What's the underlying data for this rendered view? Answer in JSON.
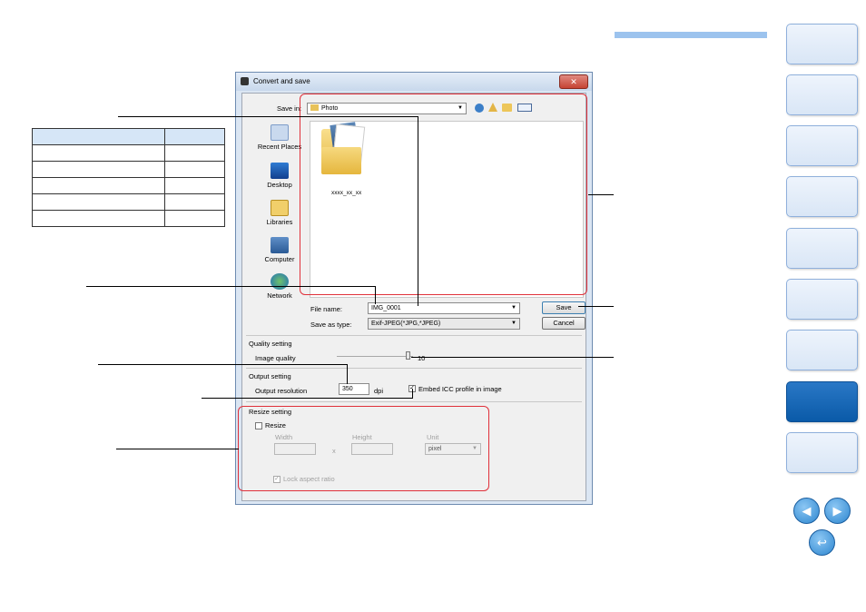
{
  "dialog": {
    "title": "Convert and save",
    "close_label": "✕",
    "save_in_label": "Save in:",
    "save_in_value": "Photo",
    "places": [
      "Recent Places",
      "Desktop",
      "Libraries",
      "Computer",
      "Network"
    ],
    "folder_name": "xxxx_xx_xx",
    "file_name_label": "File name:",
    "file_name_value": "IMG_0001",
    "save_type_label": "Save as type:",
    "save_type_value": "Exif-JPEG(*JPG,*JPEG)",
    "save_button": "Save",
    "cancel_button": "Cancel",
    "quality_section": "Quality setting",
    "image_quality_label": "Image quality",
    "image_quality_value": "10",
    "output_section": "Output setting",
    "output_resolution_label": "Output resolution",
    "output_resolution_value": "350",
    "dpi_label": "dpi",
    "embed_icc_label": "Embed ICC profile in image",
    "embed_icc_checked": true,
    "resize_section": "Resize setting",
    "resize_label": "Resize",
    "width_label": "Width",
    "height_label": "Height",
    "unit_label": "Unit",
    "times_label": "x",
    "unit_value": "pixel",
    "lock_aspect_label": "Lock aspect ratio"
  },
  "table": {
    "rows": 6,
    "cols": 2
  },
  "colors": {
    "accent_blue": "#0a5aa8",
    "highlight_red": "#e0303a"
  }
}
